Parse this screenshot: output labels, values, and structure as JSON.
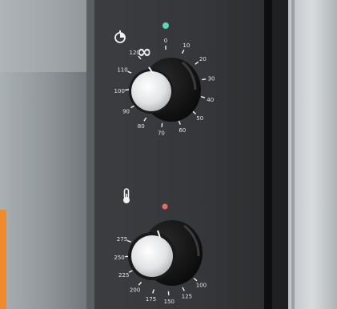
{
  "scene": {
    "subject": "oven control panel",
    "timer_dial": {
      "icon": "timer-icon",
      "infinity_label": "∞",
      "indicator_color": "#5fd3b4",
      "scale_labels": [
        "0",
        "10",
        "20",
        "30",
        "40",
        "50",
        "60",
        "70",
        "80",
        "90",
        "100",
        "110",
        "120"
      ]
    },
    "temperature_dial": {
      "icon": "thermometer-icon",
      "indicator_color": "#e07060",
      "scale_labels": [
        "100",
        "125",
        "150",
        "175",
        "200",
        "225",
        "250",
        "275"
      ]
    },
    "colors": {
      "panel": "#3a3c3f",
      "knob_face": "#e8e8e8",
      "knob_ring": "#121212",
      "accent_orange": "#f08a2a"
    }
  }
}
